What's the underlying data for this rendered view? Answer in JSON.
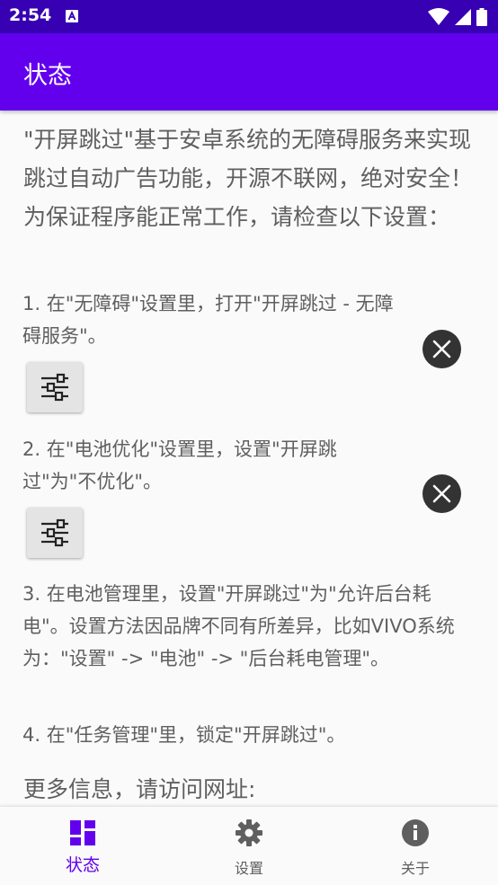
{
  "status_bar": {
    "time": "2:54",
    "notification_icon": "a-notification-icon",
    "icons": [
      "wifi-icon",
      "signal-icon",
      "battery-icon"
    ]
  },
  "app_bar": {
    "title": "状态"
  },
  "content": {
    "intro": "\"开屏跳过\"基于安卓系统的无障碍服务来实现跳过自动广告功能，开源不联网，绝对安全！为保证程序能正常工作，请检查以下设置：",
    "step1": "1. 在\"无障碍\"设置里，打开\"开屏跳过 - 无障碍服务\"。",
    "step2": "2. 在\"电池优化\"设置里，设置\"开屏跳过\"为\"不优化\"。",
    "step3": "3. 在电池管理里，设置\"开屏跳过\"为\"允许后台耗电\"。设置方法因品牌不同有所差异，比如VIVO系统为：\"设置\" -> \"电池\" -> \"后台耗电管理\"。",
    "step4": "4. 在\"任务管理\"里，锁定\"开屏跳过\"。",
    "more": "更多信息，请访问网址:"
  },
  "bottom_nav": {
    "status_label": "状态",
    "settings_label": "设置",
    "about_label": "关于"
  },
  "colors": {
    "status_bar": "#3700b3",
    "app_bar": "#6200ee",
    "accent": "#6200ee",
    "text": "#5f5f5f",
    "button": "#e4e4e4",
    "status_x": "#333333"
  }
}
